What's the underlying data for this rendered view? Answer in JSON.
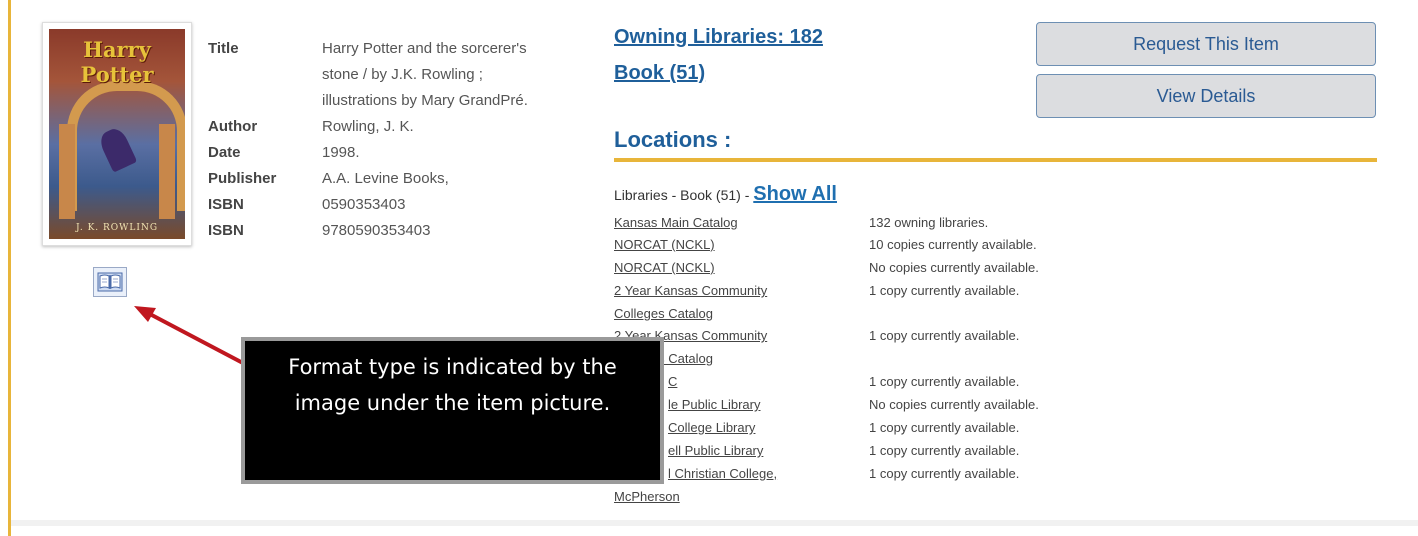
{
  "cover": {
    "title": "Harry Potter",
    "author": "J. K. ROWLING"
  },
  "format_icon": "open-book-icon",
  "metadata": [
    {
      "label": "Title",
      "value": "Harry Potter and the sorcerer's"
    },
    {
      "label": "",
      "value": "stone / by J.K. Rowling ;"
    },
    {
      "label": "",
      "value": "illustrations by Mary GrandPré."
    },
    {
      "label": "Author",
      "value": "Rowling, J. K."
    },
    {
      "label": "Date",
      "value": "1998."
    },
    {
      "label": "Publisher",
      "value": "A.A. Levine Books,"
    },
    {
      "label": "ISBN",
      "value": "0590353403"
    },
    {
      "label": "ISBN",
      "value": "9780590353403"
    }
  ],
  "owning_link": "Owning Libraries: 182",
  "book_link": "Book (51)",
  "buttons": {
    "request": "Request This Item",
    "details": "View Details"
  },
  "locations_heading": "Locations :",
  "libraries_head": "Libraries - Book (51) - ",
  "show_all": "Show All",
  "libraries": [
    {
      "name": "Kansas Main Catalog",
      "status": "132 owning libraries."
    },
    {
      "name": "NORCAT (NCKL)",
      "status": "10 copies currently available."
    },
    {
      "name": "NORCAT (NCKL)",
      "status": "No copies currently available."
    },
    {
      "name": "2 Year Kansas Community",
      "status": "1 copy currently available."
    },
    {
      "name": "Colleges Catalog",
      "status": ""
    },
    {
      "name": "2 Year Kansas Community",
      "status": "1 copy currently available."
    },
    {
      "name": "Colleges Catalog",
      "status": ""
    },
    {
      "name": "C",
      "status": "1 copy currently available."
    },
    {
      "name": "le Public Library",
      "status": "No copies currently available."
    },
    {
      "name": "College Library",
      "status": "1 copy currently available."
    },
    {
      "name": "ell Public Library",
      "status": "1 copy currently available."
    },
    {
      "name": "l Christian College,",
      "status": "1 copy currently available."
    },
    {
      "name": "McPherson",
      "status": ""
    }
  ],
  "callout": {
    "line1": "Format type is indicated by the",
    "line2": "image under the item picture."
  },
  "colors": {
    "accent": "#e8b53a",
    "link": "#1f5f9a",
    "arrow": "#c0171f"
  }
}
